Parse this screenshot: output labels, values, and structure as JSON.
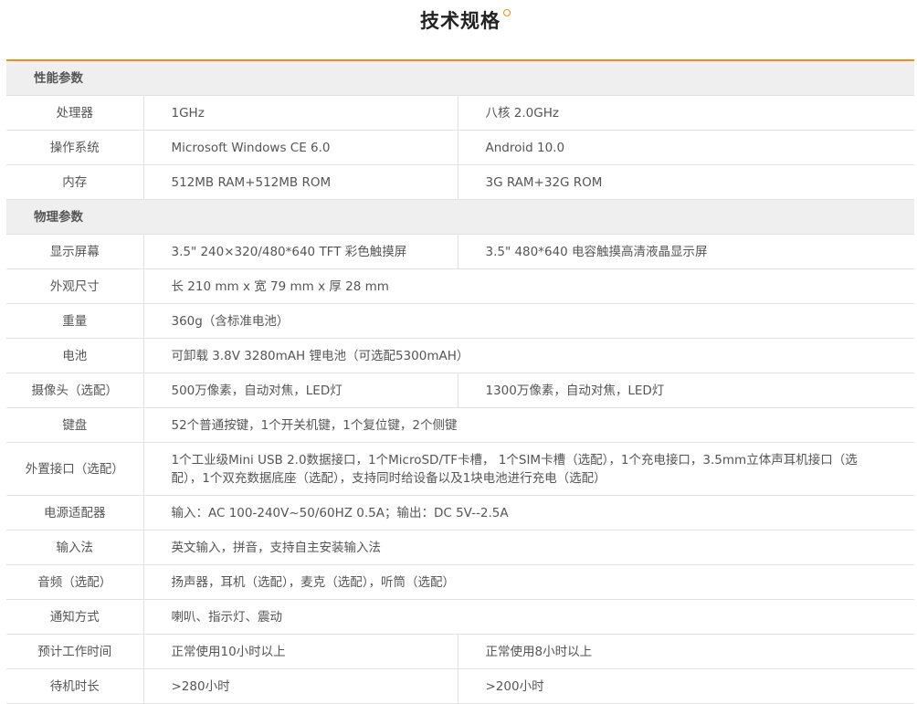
{
  "title": "技术规格",
  "sections": [
    {
      "name": "性能参数",
      "rows": [
        {
          "label": "处理器",
          "v1": "1GHz",
          "v2": "八核 2.0GHz"
        },
        {
          "label": "操作系统",
          "v1": "Microsoft Windows CE 6.0",
          "v2": "Android 10.0"
        },
        {
          "label": "内存",
          "v1": "512MB RAM+512MB ROM",
          "v2": "3G RAM+32G ROM"
        }
      ]
    },
    {
      "name": "物理参数",
      "rows": [
        {
          "label": "显示屏幕",
          "v1": "3.5\" 240×320/480*640 TFT 彩色触摸屏",
          "v2": "3.5\" 480*640 电容触摸高清液晶显示屏"
        },
        {
          "label": "外观尺寸",
          "v1": "长 210 mm x 宽 79 mm x 厚 28 mm"
        },
        {
          "label": "重量",
          "v1": "360g（含标准电池）"
        },
        {
          "label": "电池",
          "v1": "可卸载 3.8V 3280mAH 锂电池（可选配5300mAH）"
        },
        {
          "label": "摄像头（选配）",
          "v1": "500万像素，自动对焦，LED灯",
          "v2": "1300万像素，自动对焦，LED灯"
        },
        {
          "label": "键盘",
          "v1": "52个普通按键，1个开关机键，1个复位键，2个侧键"
        },
        {
          "label": "外置接口（选配）",
          "v1": "1个工业级Mini USB 2.0数据接口，1个MicroSD/TF卡槽， 1个SIM卡槽（选配），1个充电接口，3.5mm立体声耳机接口（选配），1个双充数据底座（选配），支持同时给设备以及1块电池进行充电（选配）"
        },
        {
          "label": "电源适配器",
          "v1": "输入：AC 100-240V~50/60HZ 0.5A；输出：DC 5V--2.5A"
        },
        {
          "label": "输入法",
          "v1": "英文输入，拼音，支持自主安装输入法"
        },
        {
          "label": "音频（选配）",
          "v1": "扬声器，耳机（选配），麦克（选配），听筒（选配）"
        },
        {
          "label": "通知方式",
          "v1": "喇叭、指示灯、震动"
        },
        {
          "label": "预计工作时间",
          "v1": "正常使用10小时以上",
          "v2": "正常使用8小时以上"
        },
        {
          "label": "待机时长",
          "v1": ">280小时",
          "v2": ">200小时"
        }
      ]
    }
  ]
}
